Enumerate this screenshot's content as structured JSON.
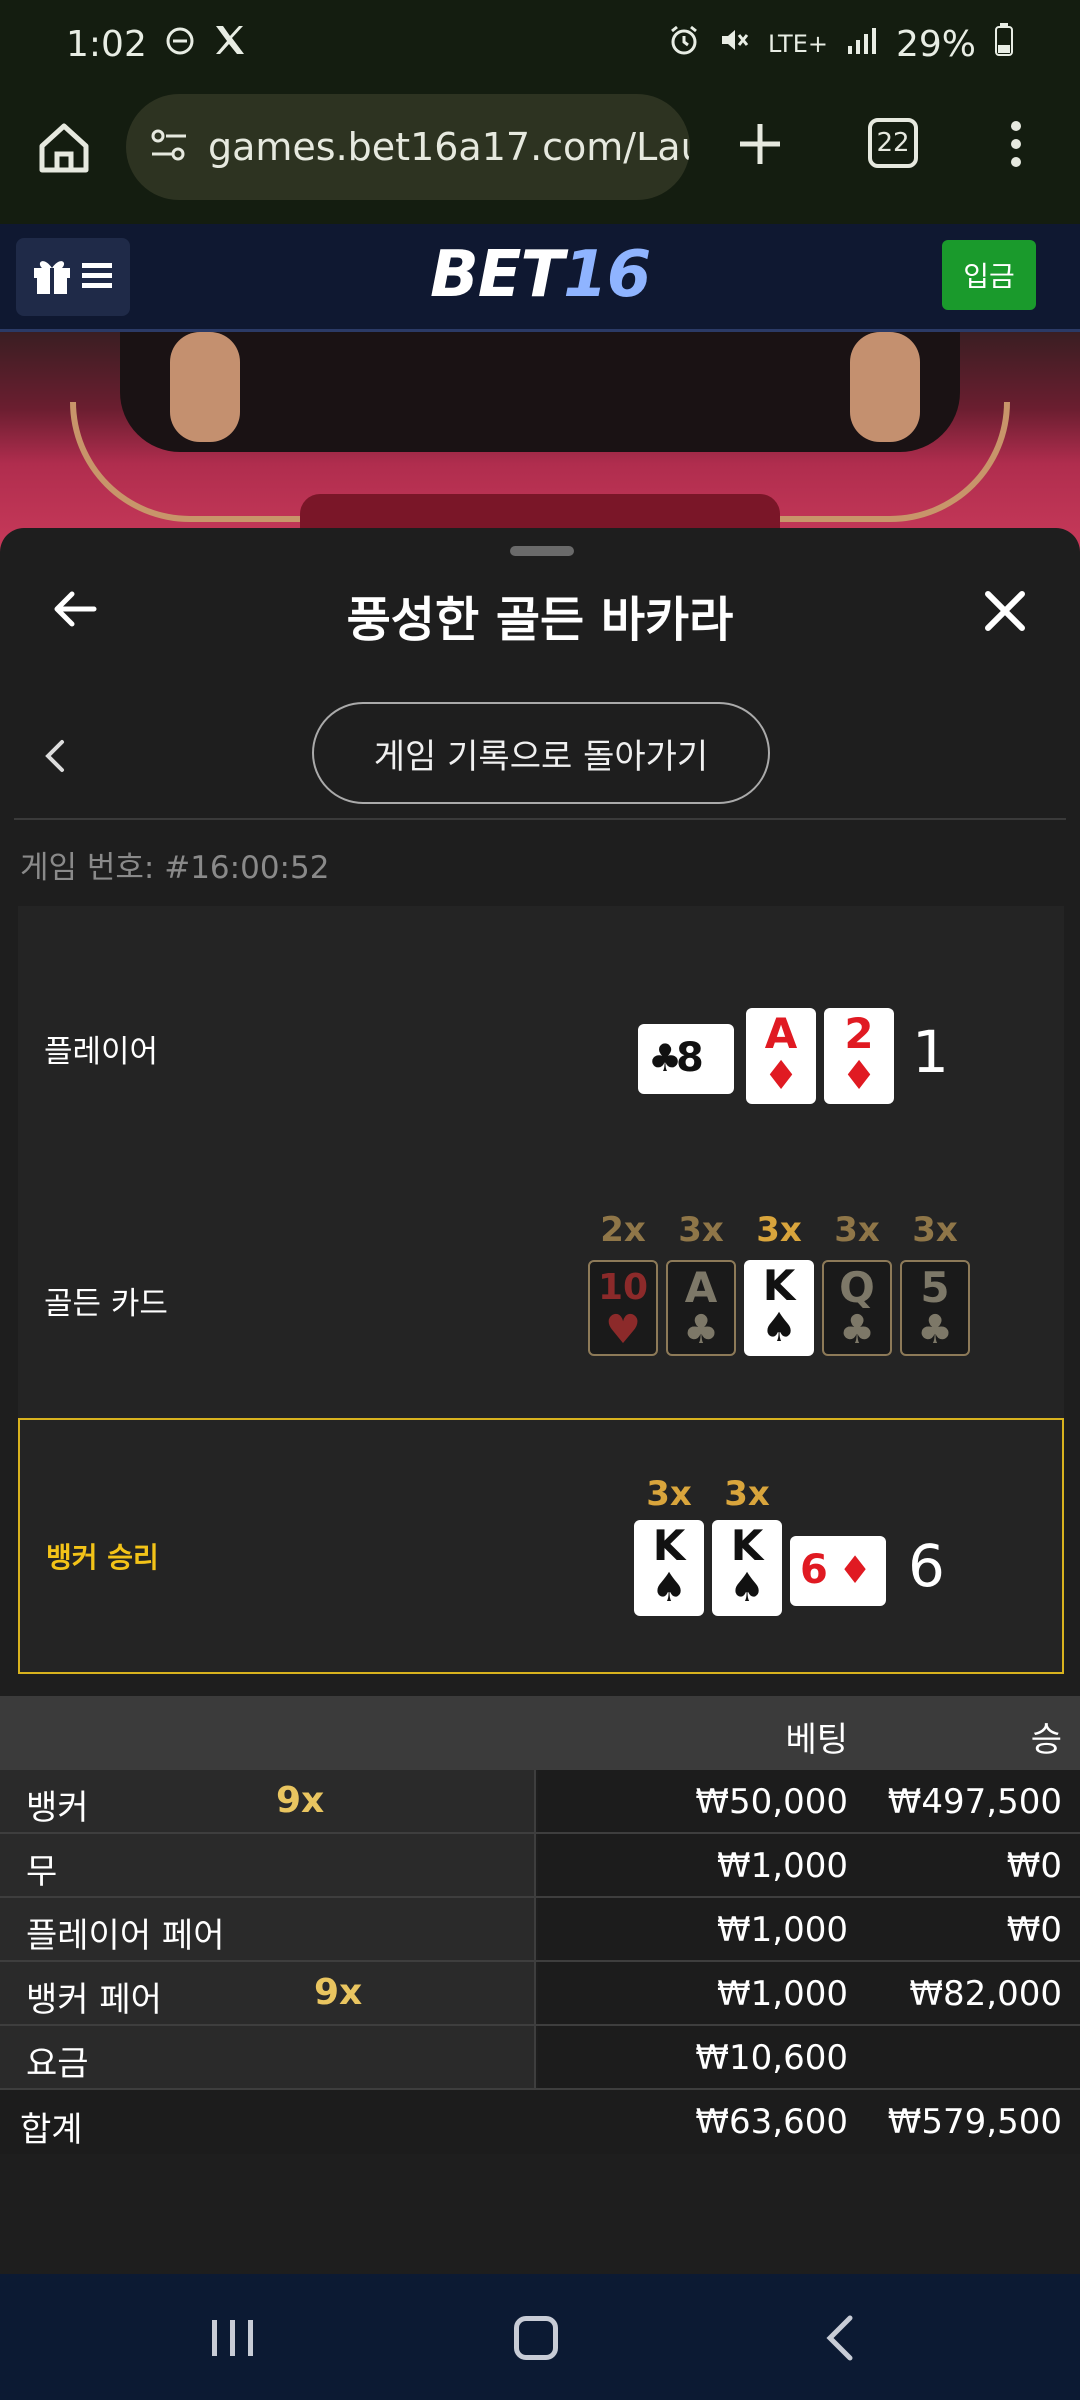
{
  "status_bar": {
    "time": "1:02",
    "battery": "29%",
    "network": "LTE+"
  },
  "browser": {
    "url": "games.bet16a17.com/Launc",
    "tab_count": "22"
  },
  "site_header": {
    "logo_bet": "BET",
    "logo_num": "16",
    "deposit_label": "입금"
  },
  "panel": {
    "title": "풍성한 골든 바카라",
    "back_to_history": "게임 기록으로 돌아가기",
    "game_number": "게임 번호: #16:00:52"
  },
  "rows": {
    "player": {
      "label": "플레이어",
      "score": "1",
      "cards": [
        {
          "rank": "8",
          "suit": "♣",
          "color": "black",
          "orientation": "sideways"
        },
        {
          "rank": "A",
          "suit": "♦",
          "color": "red"
        },
        {
          "rank": "2",
          "suit": "♦",
          "color": "red"
        }
      ]
    },
    "golden": {
      "label": "골든 카드",
      "cards": [
        {
          "mult": "2x",
          "rank": "10",
          "suit": "♥",
          "color": "red",
          "active": false
        },
        {
          "mult": "3x",
          "rank": "A",
          "suit": "♣",
          "color": "black",
          "active": false
        },
        {
          "mult": "3x",
          "rank": "K",
          "suit": "♠",
          "color": "black",
          "active": true
        },
        {
          "mult": "3x",
          "rank": "Q",
          "suit": "♣",
          "color": "black",
          "active": false
        },
        {
          "mult": "3x",
          "rank": "5",
          "suit": "♣",
          "color": "black",
          "active": false
        }
      ]
    },
    "banker": {
      "label": "뱅커 승리",
      "score": "6",
      "cards": [
        {
          "mult": "3x",
          "rank": "K",
          "suit": "♠",
          "color": "black"
        },
        {
          "mult": "3x",
          "rank": "K",
          "suit": "♠",
          "color": "black"
        },
        {
          "rank": "6",
          "suit": "♦",
          "color": "red",
          "orientation": "sideways"
        }
      ]
    }
  },
  "bets": {
    "header_bet": "베팅",
    "header_win": "승",
    "rows": [
      {
        "name": "뱅커",
        "mult": "9x",
        "bet": "₩50,000",
        "win": "₩497,500"
      },
      {
        "name": "무",
        "mult": "",
        "bet": "₩1,000",
        "win": "₩0"
      },
      {
        "name": "플레이어 페어",
        "mult": "",
        "bet": "₩1,000",
        "win": "₩0"
      },
      {
        "name": "뱅커 페어",
        "mult": "9x",
        "bet": "₩1,000",
        "win": "₩82,000"
      },
      {
        "name": "요금",
        "mult": "",
        "bet": "₩10,600",
        "win": ""
      }
    ],
    "total": {
      "name": "합계",
      "bet": "₩63,600",
      "win": "₩579,500"
    }
  },
  "colors": {
    "accent_gold": "#f3c318",
    "deposit_green": "#1a9a2c",
    "header_navy": "#0f1831"
  }
}
